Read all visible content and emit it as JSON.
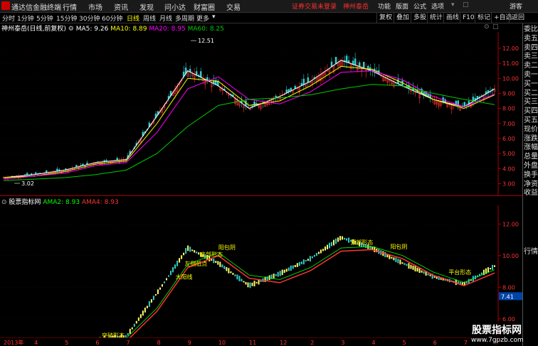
{
  "titlebar": {
    "app_name": "通达信金融终端",
    "menus": [
      "行情",
      "市场",
      "资讯",
      "发现",
      "问小达",
      "财富圈",
      "交易"
    ],
    "warning": "证券交易未登录",
    "stock_name": "神州泰岳",
    "right_menus": [
      "功能",
      "版面",
      "公式",
      "选项"
    ],
    "user": "游客"
  },
  "toolbar": {
    "periods": [
      "分时",
      "1分钟",
      "5分钟",
      "15分钟",
      "30分钟",
      "60分钟",
      "日线",
      "周线",
      "月线",
      "多周期",
      "更多"
    ],
    "active_period": "日线",
    "right_buttons": [
      "复权",
      "叠加",
      "多股",
      "统计",
      "画线",
      "F10",
      "标记",
      "+自选",
      "返回"
    ]
  },
  "infobar": {
    "title": "神州泰岳(日线,前复权)",
    "ma5": "MA5: 9.26",
    "ma10": "MA10: 8.89",
    "ma20": "MA20: 8.95",
    "ma60": "MA60: 8.25"
  },
  "indicator_bar": {
    "title": "股票指标网",
    "ama2": "AMA2: 8.93",
    "ama4": "AMA4: 8.93"
  },
  "sidebar_items": [
    "委比",
    "卖五",
    "卖四",
    "卖三",
    "卖二",
    "卖一",
    "买一",
    "买二",
    "买三",
    "买四",
    "买五",
    "现价",
    "涨跌",
    "涨幅",
    "总量",
    "外盘",
    "换手",
    "净资",
    "收益",
    "行情"
  ],
  "chart_labels": {
    "high_price": "12.51",
    "low_price": "3.02",
    "current_ind": "7.41"
  },
  "main_axis": {
    "ticks": [
      "12.00",
      "11.00",
      "10.00",
      "9.00",
      "8.00",
      "7.00",
      "6.00",
      "5.00",
      "4.00",
      "3.00"
    ]
  },
  "ind_axis": {
    "ticks": [
      "12.00",
      "10.00",
      "8.00",
      "6.00"
    ]
  },
  "date_axis": {
    "labels": [
      "2013年",
      "4",
      "5",
      "6",
      "7",
      "8",
      "9",
      "10",
      "11",
      "12",
      "2",
      "3",
      "4",
      "5",
      "6",
      "7",
      "8"
    ]
  },
  "annotations": [
    "突破形态",
    "大阳线",
    "左侧低点",
    "底部形态",
    "阳包阴",
    "顶部形态",
    "平台形态"
  ],
  "watermark": {
    "name": "股票指标网",
    "url": "www.7gpzb.com"
  },
  "colors": {
    "up": "#ff3333",
    "down": "#33cccc",
    "ma5": "#ffffff",
    "ma10": "#ffff00",
    "ma20": "#ff00ff",
    "ma60": "#00cc00",
    "accent": "#ffff00"
  },
  "chart_data": {
    "type": "line",
    "title": "神州泰岳(日线,前复权)",
    "x": [
      "2013年",
      "4",
      "5",
      "6",
      "7",
      "8",
      "9",
      "10",
      "11",
      "12",
      "2",
      "3",
      "4",
      "5",
      "6",
      "7",
      "8"
    ],
    "ylim": [
      2.5,
      12.8
    ],
    "series": [
      {
        "name": "MA5: 9.26",
        "values": [
          3.4,
          3.6,
          3.9,
          4.4,
          4.6,
          7.5,
          10.5,
          9.5,
          8.0,
          8.8,
          9.8,
          11.2,
          10.5,
          9.5,
          8.6,
          8.1,
          9.3
        ]
      },
      {
        "name": "MA10: 8.89",
        "values": [
          3.4,
          3.5,
          3.8,
          4.3,
          4.5,
          7.0,
          10.0,
          9.8,
          8.2,
          8.5,
          9.5,
          10.8,
          10.6,
          9.7,
          8.6,
          8.0,
          8.9
        ]
      },
      {
        "name": "MA20: 8.95",
        "values": [
          3.3,
          3.5,
          3.7,
          4.2,
          4.4,
          6.4,
          9.3,
          10.1,
          8.6,
          8.3,
          9.1,
          10.4,
          10.5,
          9.9,
          8.8,
          8.1,
          8.95
        ]
      },
      {
        "name": "MA60: 8.25",
        "values": [
          3.2,
          3.3,
          3.4,
          3.6,
          3.9,
          5.0,
          6.8,
          8.2,
          8.6,
          8.7,
          8.9,
          9.3,
          9.6,
          9.5,
          9.0,
          8.6,
          8.25
        ]
      }
    ]
  }
}
